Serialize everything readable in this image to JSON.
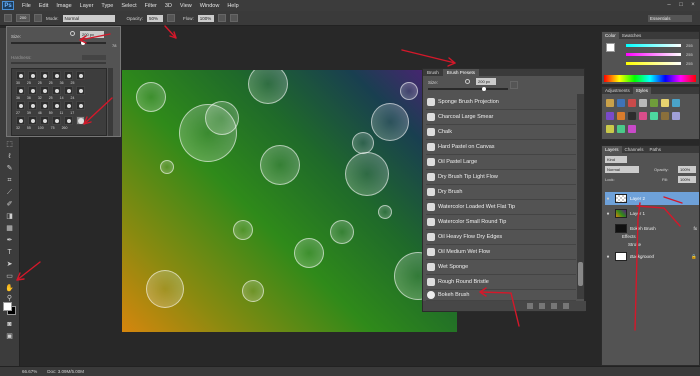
{
  "menubar": {
    "logo": "Ps",
    "items": [
      "File",
      "Edit",
      "Image",
      "Layer",
      "Type",
      "Select",
      "Filter",
      "3D",
      "View",
      "Window",
      "Help"
    ]
  },
  "options": {
    "brush_size": "200",
    "mode_label": "Mode:",
    "mode_value": "Normal",
    "opacity_label": "Opacity:",
    "opacity_value": "50%",
    "flow_label": "Flow:",
    "flow_value": "100%",
    "workspace": "Essentials"
  },
  "brush_picker": {
    "size_label": "Size:",
    "size_value": "200 px",
    "size_reset": "78",
    "hardness_label": "Hardness:",
    "sizes_row1": [
      "30",
      "25",
      "25",
      "25",
      "36",
      "25"
    ],
    "sizes_row2": [
      "36",
      "36",
      "32",
      "25",
      "14",
      "24"
    ],
    "sizes_row3": [
      "27",
      "39",
      "46",
      "59",
      "11",
      "17"
    ],
    "sizes_row4": [
      "23",
      "36",
      "44",
      "60",
      "14",
      "26"
    ],
    "sizes_row5": [
      "33",
      "42",
      "55",
      "70",
      "112",
      "134"
    ],
    "sizes_row6": [
      "74",
      "95",
      "29",
      "192",
      "36",
      "33"
    ],
    "sizes_row7": [
      "63",
      "66",
      "39",
      "63",
      "11",
      "48"
    ],
    "sizes_row8": [
      "32",
      "55",
      "100",
      "75",
      "260",
      ""
    ]
  },
  "brush_panel": {
    "tab_brush": "Brush",
    "tab_presets": "Brush Presets",
    "size_label": "Size:",
    "size_value": "200 px",
    "presets": [
      "Sponge Brush Projection",
      "Charcoal Large Smear",
      "Chalk",
      "Hard Pastel on Canvas",
      "Oil Pastel Large",
      "Dry Brush Tip Light Flow",
      "Dry Brush",
      "Watercolor Loaded Wet Flat Tip",
      "Watercolor Small Round Tip",
      "Oil Heavy Flow Dry Edges",
      "Oil Medium Wet Flow",
      "Wet Sponge",
      "Rough Round Bristle",
      "Bokeh Brush"
    ]
  },
  "color_panel": {
    "tab_color": "Color",
    "tab_swatches": "Swatches",
    "r": "255",
    "g": "255",
    "b": "255"
  },
  "adjust_panel": {
    "tab_adjustments": "Adjustments",
    "tab_styles": "Styles"
  },
  "layers_panel": {
    "tab_layers": "Layers",
    "tab_channels": "Channels",
    "tab_paths": "Paths",
    "kind": "Kind",
    "blend": "Normal",
    "opacity_label": "Opacity:",
    "opacity_value": "100%",
    "lock_label": "Lock:",
    "fill_label": "Fill:",
    "fill_value": "100%",
    "layers": [
      "Layer 2",
      "Layer 1",
      "Bokeh Brush",
      "Effects",
      "Stroke",
      "Background"
    ],
    "fx": "fx"
  },
  "statusbar": {
    "zoom": "66.67%",
    "doc": "Doc: 3.09M/5.00M"
  },
  "colors": {
    "accent": "#6ea1d9",
    "annotation": "#d4182a"
  }
}
